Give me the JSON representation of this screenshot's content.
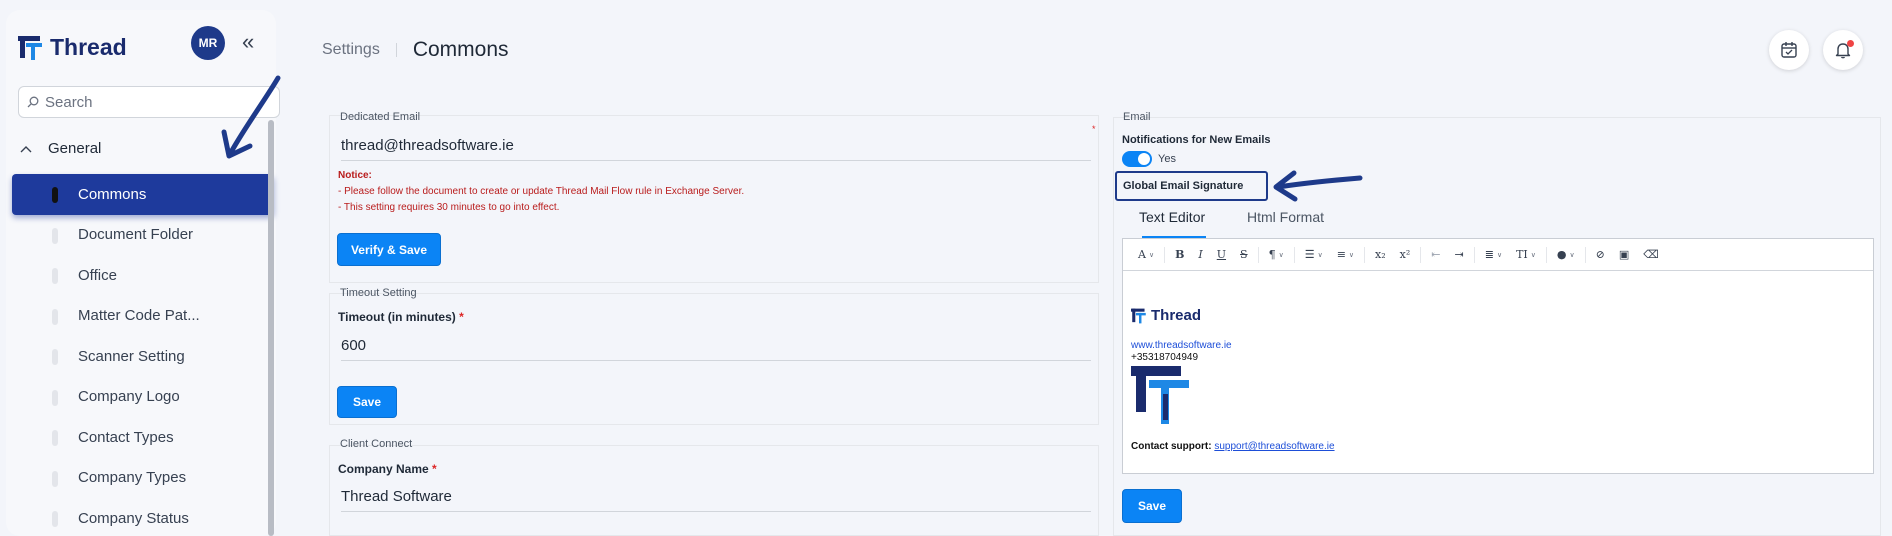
{
  "app": {
    "name": "Thread",
    "user_initials": "MR"
  },
  "search": {
    "placeholder": "Search"
  },
  "sidebar": {
    "group_label": "General",
    "items": [
      {
        "label": "Commons",
        "active": true
      },
      {
        "label": "Document Folder"
      },
      {
        "label": "Office"
      },
      {
        "label": "Matter Code Pat..."
      },
      {
        "label": "Scanner Setting"
      },
      {
        "label": "Company Logo"
      },
      {
        "label": "Contact Types"
      },
      {
        "label": "Company Types"
      },
      {
        "label": "Company Status"
      }
    ]
  },
  "header": {
    "breadcrumb_parent": "Settings",
    "title": "Commons"
  },
  "dedicated_email": {
    "section_title": "Dedicated Email",
    "value": "thread@threadsoftware.ie",
    "notice_title": "Notice:",
    "notice_lines": [
      "- Please follow the document to create or update Thread Mail Flow rule in Exchange Server.",
      "- This setting requires 30 minutes to go into effect."
    ],
    "button": "Verify & Save"
  },
  "timeout": {
    "section_title": "Timeout Setting",
    "label": "Timeout (in minutes)",
    "required": "*",
    "value": "600",
    "button": "Save"
  },
  "client_connect": {
    "section_title": "Client Connect",
    "label": "Company Name",
    "required": "*",
    "value": "Thread Software"
  },
  "email": {
    "section_title": "Email",
    "notifications_label": "Notifications for New Emails",
    "toggle_value": "Yes",
    "signature_label": "Global Email Signature",
    "tabs": [
      "Text Editor",
      "Html Format"
    ],
    "active_tab": "Text Editor",
    "signature": {
      "brand": "Thread",
      "website": "www.threadsoftware.ie",
      "phone": "+35318704949",
      "support_label": "Contact support:",
      "support_email": "support@threadsoftware.ie"
    },
    "button": "Save"
  },
  "colors": {
    "primary": "#0b84f5",
    "nav_active": "#1e3a9c",
    "brand_dark": "#1a2b6d",
    "required": "#dc2626"
  }
}
